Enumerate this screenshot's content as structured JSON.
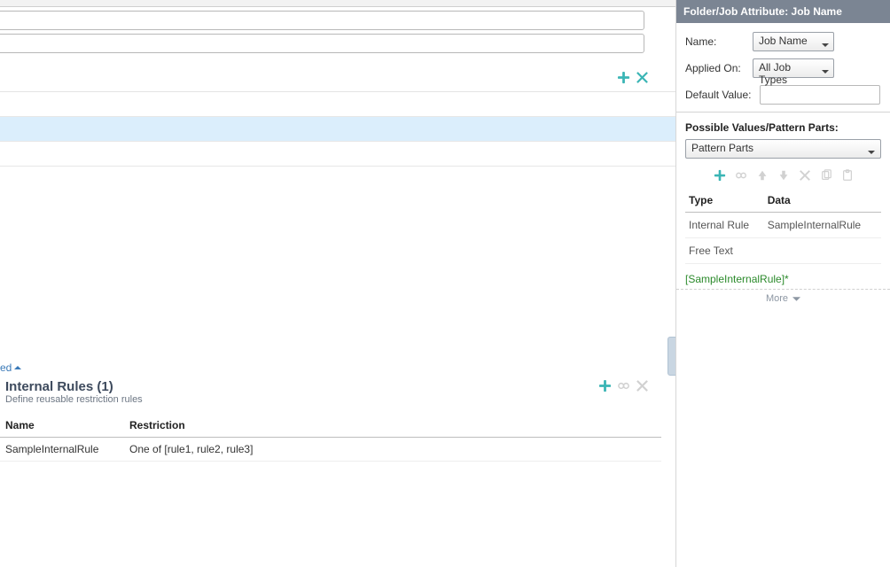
{
  "side": {
    "header": "Folder/Job Attribute: Job Name",
    "name_label": "Name:",
    "name_value": "Job Name",
    "applied_label": "Applied On:",
    "applied_value": "All Job Types",
    "default_label": "Default Value:",
    "default_value": "",
    "pv_label": "Possible Values/Pattern Parts:",
    "pv_select": "Pattern Parts",
    "table": {
      "type_h": "Type",
      "data_h": "Data",
      "rows": [
        {
          "type": "Internal Rule",
          "data": "SampleInternalRule"
        },
        {
          "type": "Free Text",
          "data": ""
        }
      ]
    },
    "preview": "[SampleInternalRule]*",
    "more": "More"
  },
  "main": {
    "ed_link": "ed",
    "section_title": "Internal Rules (1)",
    "section_sub": "Define reusable restriction rules",
    "table": {
      "name_h": "Name",
      "restriction_h": "Restriction",
      "rows": [
        {
          "name": "SampleInternalRule",
          "restriction": "One of [rule1, rule2, rule3]"
        }
      ]
    }
  }
}
